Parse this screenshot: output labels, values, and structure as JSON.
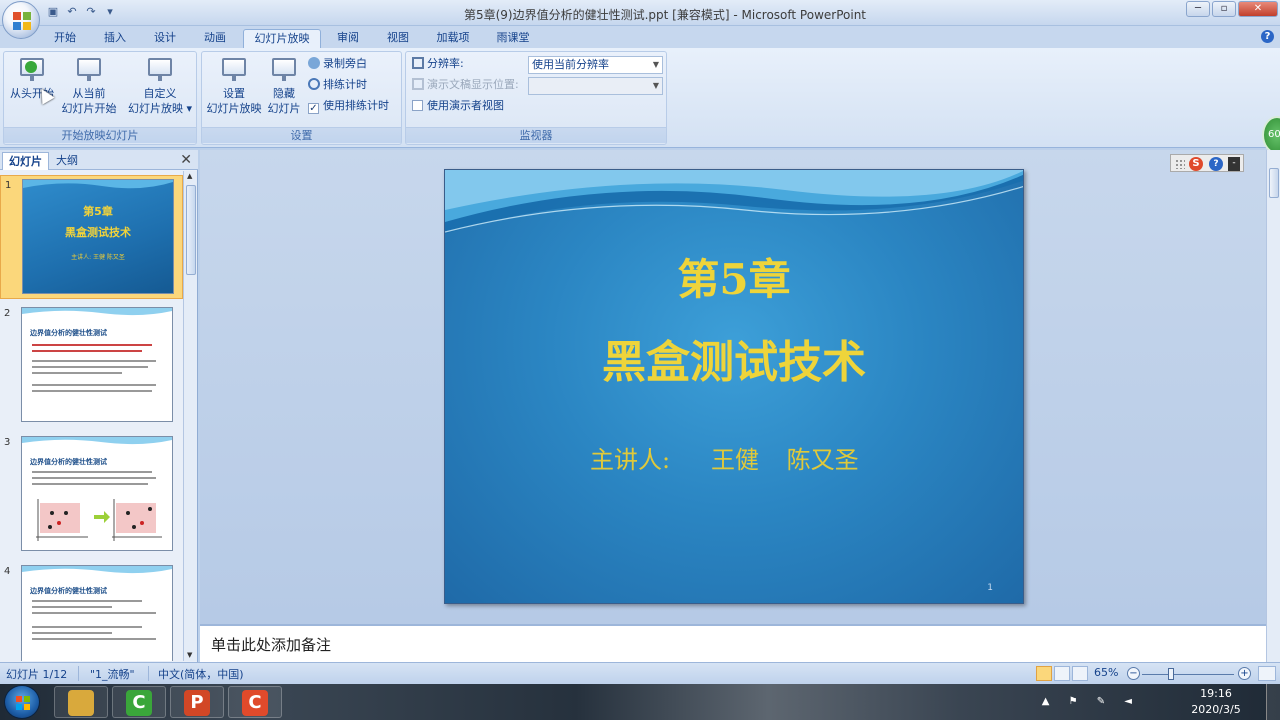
{
  "window": {
    "title": "第5章(9)边界值分析的健壮性测试.ppt [兼容模式] - Microsoft PowerPoint",
    "controls": [
      "─",
      "▫",
      "✕"
    ]
  },
  "ribbon": {
    "tabs": [
      "开始",
      "插入",
      "设计",
      "动画",
      "幻灯片放映",
      "审阅",
      "视图",
      "加载项",
      "雨课堂"
    ],
    "active_tab": "幻灯片放映",
    "groups": {
      "start_show": {
        "label": "开始放映幻灯片",
        "from_beginning_label": "从头开始",
        "from_current_line1": "从当前",
        "from_current_line2": "幻灯片开始",
        "custom_line1": "自定义",
        "custom_line2": "幻灯片放映 ▾"
      },
      "setup": {
        "label": "设置",
        "setup_line1": "设置",
        "setup_line2": "幻灯片放映",
        "hide_line1": "隐藏",
        "hide_line2": "幻灯片",
        "record_narration": "录制旁白",
        "rehearse_timings": "排练计时",
        "use_rehearsed_timings": "使用排练计时",
        "use_rehearsed_checked": true
      },
      "monitors": {
        "label": "监视器",
        "resolution_label": "分辨率:",
        "resolution_value": "使用当前分辨率",
        "show_on_label": "演示文稿显示位置:",
        "show_on_value": "",
        "presenter_view_label": "使用演示者视图",
        "presenter_view_checked": false
      }
    },
    "side_badge": "60"
  },
  "left_pane": {
    "tabs": [
      "幻灯片",
      "大纲"
    ],
    "active_tab": "幻灯片",
    "thumbnails": [
      {
        "num": "1",
        "lines": [
          "第5章",
          "黑盒测试技术",
          "主讲人:  王健  陈又圣"
        ]
      },
      {
        "num": "2",
        "title": "边界值分析的健壮性测试"
      },
      {
        "num": "3",
        "title": "边界值分析的健壮性测试"
      },
      {
        "num": "4",
        "title": "边界值分析的健壮性测试"
      }
    ]
  },
  "slide": {
    "chapter": "第5章",
    "title": "黑盒测试技术",
    "presenter_label": "主讲人:",
    "presenters": "王健  陈又圣",
    "page_number": "1"
  },
  "float_toolbar": {
    "s_label": "S",
    "help_label": "?",
    "menu_label": "-"
  },
  "notes": {
    "placeholder": "单击此处添加备注"
  },
  "statusbar": {
    "slide_position": "幻灯片 1/12",
    "theme": "\"1_流畅\"",
    "language": "中文(简体，中国)",
    "zoom": "65%",
    "zoom_minus": "−",
    "zoom_plus": "+"
  },
  "taskbar": {
    "apps": [
      {
        "name": "file-explorer",
        "glyph": "📁",
        "color": "#d9a93c"
      },
      {
        "name": "camtasia-green",
        "glyph": "C",
        "color": "#3aa63a"
      },
      {
        "name": "powerpoint",
        "glyph": "P",
        "color": "#d24726"
      },
      {
        "name": "camtasia-recorder",
        "glyph": "C",
        "color": "#e04a2b"
      }
    ],
    "time": "19:16",
    "date": "2020/3/5"
  }
}
